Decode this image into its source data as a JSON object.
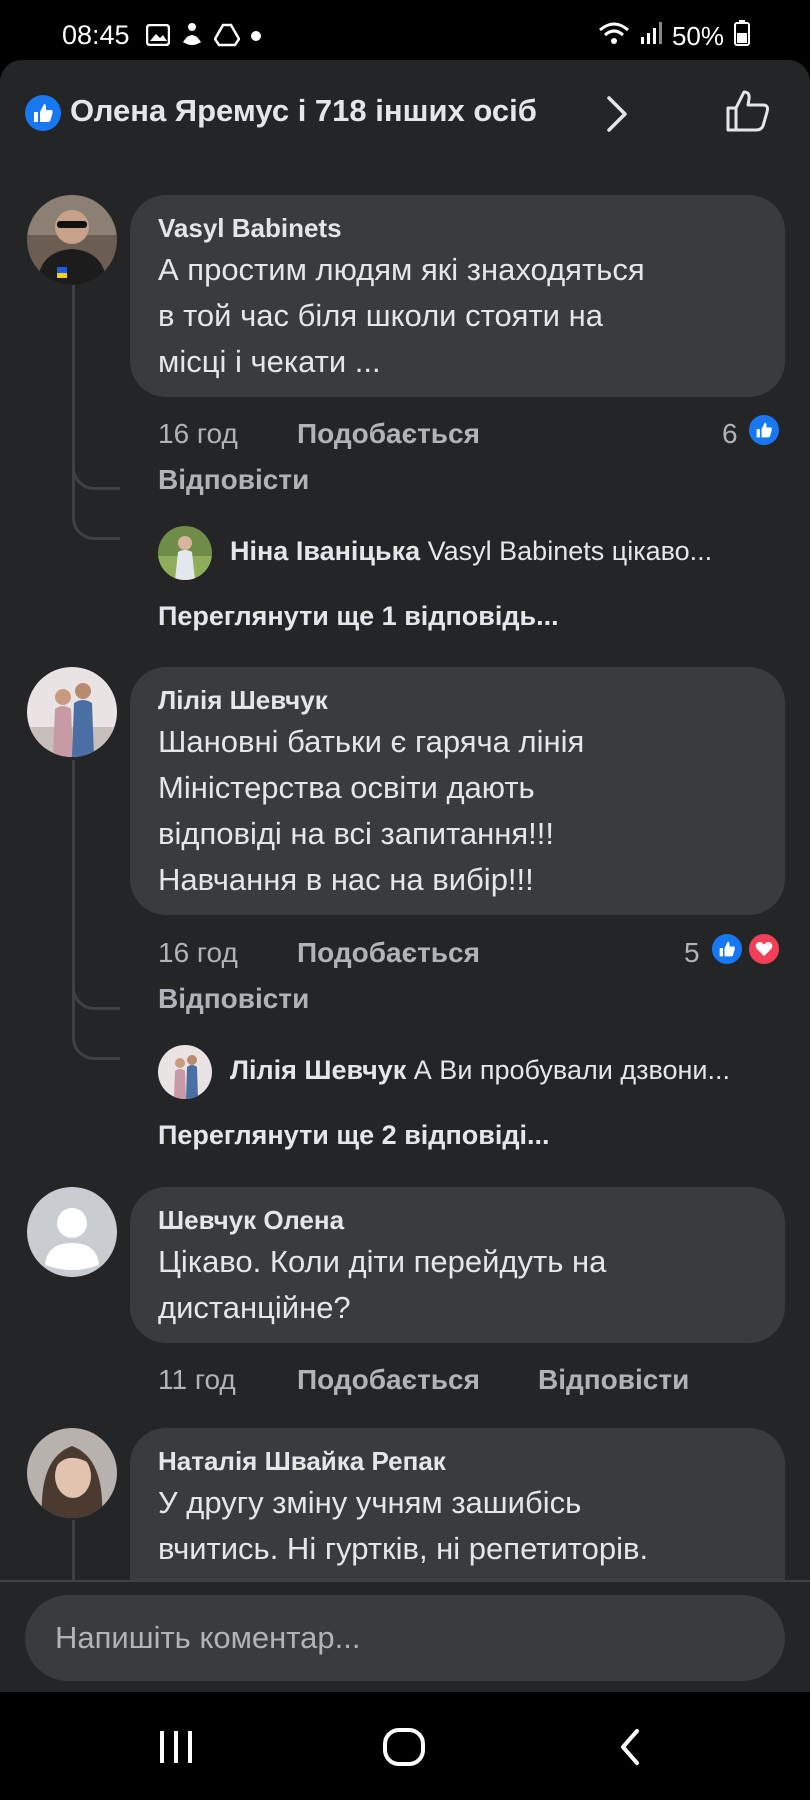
{
  "status_bar": {
    "time": "08:45",
    "battery": "50%",
    "icons": [
      "gallery-icon",
      "accessibility-icon",
      "drive-icon",
      "dot-icon",
      "wifi-icon",
      "signal-icon",
      "battery-icon"
    ]
  },
  "header": {
    "text": "Олена Яремус і 718 інших осіб"
  },
  "comments": [
    {
      "author": "Vasyl  Babinets",
      "lines": [
        "А простим людям які знаходяться",
        "в той час біля школи стояти на",
        "місці і чекати ..."
      ],
      "time": "16 год",
      "like": "Подобається",
      "reply": "Відповісти",
      "reaction_count": "6",
      "reply_preview": {
        "author": "Ніна Іваніцька",
        "text": "Vasyl  Babinets цікаво..."
      },
      "view_more": "Переглянути ще 1 відповідь..."
    },
    {
      "author": "Лілія Шевчук",
      "lines": [
        "Шановні батьки є гаряча лінія",
        "Міністерства освіти дають",
        "відповіді на всі запитання!!!",
        "Навчання в нас на вибір!!!"
      ],
      "time": "16 год",
      "like": "Подобається",
      "reply": "Відповісти",
      "reaction_count": "5",
      "reply_preview": {
        "author": "Лілія Шевчук",
        "text": "А Ви пробували дзвони..."
      },
      "view_more": "Переглянути ще 2 відповіді..."
    },
    {
      "author": "Шевчук Олена",
      "lines": [
        "Цікаво. Коли діти перейдуть на",
        "дистанційне?"
      ],
      "time": "11 год",
      "like": "Подобається",
      "reply": "Відповісти"
    },
    {
      "author": "Наталія Швайка Репак",
      "lines": [
        "У другу зміну учням зашибісь",
        "вчитись. Ні гуртків, ні репетиторів."
      ]
    }
  ],
  "composer": {
    "placeholder": "Напишіть коментар..."
  },
  "colors": {
    "like_blue": "#1877f2",
    "love_red": "#f33e58",
    "bubble": "#3a3b3c",
    "sheet": "#242526"
  }
}
